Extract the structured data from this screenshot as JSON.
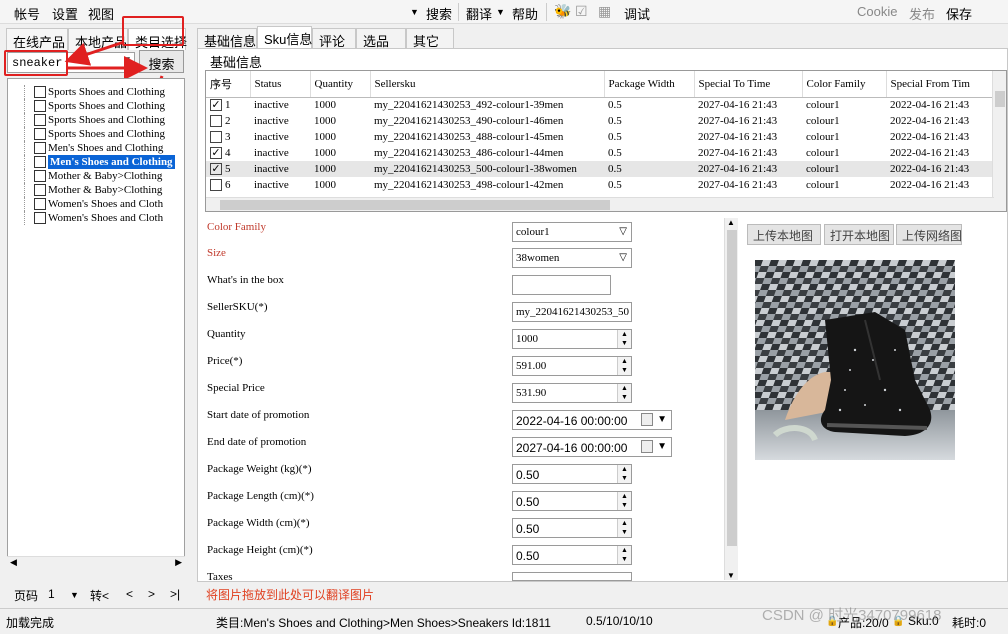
{
  "menu": {
    "account": "帐号",
    "settings": "设置",
    "view": "视图",
    "search": "搜索",
    "translate": "翻译",
    "help": "帮助",
    "debug": "调试",
    "cookie": "Cookie",
    "publish": "发布",
    "save": "保存"
  },
  "left_tabs": [
    "在线产品",
    "本地产品",
    "类目选择"
  ],
  "search": {
    "value": "sneaker",
    "button": "搜索"
  },
  "tree": [
    "Sports Shoes and Clothing",
    "Sports Shoes and Clothing",
    "Sports Shoes and Clothing",
    "Sports Shoes and Clothing",
    "Men's Shoes and Clothing",
    "Men's Shoes and Clothing",
    "Mother & Baby>Clothing",
    "Mother & Baby>Clothing",
    "Women's Shoes and Cloth",
    "Women's Shoes and Cloth"
  ],
  "pager": {
    "label": "页码",
    "page": "1",
    "goto": "转<",
    "prev": "<",
    "next": ">",
    "last": ">|"
  },
  "right_tabs": [
    "基础信息",
    "Sku信息",
    "评论",
    "选品",
    "其它"
  ],
  "group_title": "基础信息",
  "grid": {
    "headers": [
      "序号",
      "Status",
      "Quantity",
      "Sellersku",
      "Package Width",
      "Special To Time",
      "Color Family",
      "Special From Tim"
    ],
    "rows": [
      {
        "checked": true,
        "no": "1",
        "status": "inactive",
        "qty": "1000",
        "sku": "my_22041621430253_492-colour1-39men",
        "width": "0.5",
        "to": "2027-04-16 21:43",
        "color": "colour1",
        "from": "2022-04-16 21:43"
      },
      {
        "checked": false,
        "no": "2",
        "status": "inactive",
        "qty": "1000",
        "sku": "my_22041621430253_490-colour1-46men",
        "width": "0.5",
        "to": "2027-04-16 21:43",
        "color": "colour1",
        "from": "2022-04-16 21:43"
      },
      {
        "checked": false,
        "no": "3",
        "status": "inactive",
        "qty": "1000",
        "sku": "my_22041621430253_488-colour1-45men",
        "width": "0.5",
        "to": "2027-04-16 21:43",
        "color": "colour1",
        "from": "2022-04-16 21:43"
      },
      {
        "checked": true,
        "no": "4",
        "status": "inactive",
        "qty": "1000",
        "sku": "my_22041621430253_486-colour1-44men",
        "width": "0.5",
        "to": "2027-04-16 21:43",
        "color": "colour1",
        "from": "2022-04-16 21:43"
      },
      {
        "checked": true,
        "no": "5",
        "status": "inactive",
        "qty": "1000",
        "sku": "my_22041621430253_500-colour1-38women",
        "width": "0.5",
        "to": "2027-04-16 21:43",
        "color": "colour1",
        "from": "2022-04-16 21:43"
      },
      {
        "checked": false,
        "no": "6",
        "status": "inactive",
        "qty": "1000",
        "sku": "my_22041621430253_498-colour1-42men",
        "width": "0.5",
        "to": "2027-04-16 21:43",
        "color": "colour1",
        "from": "2022-04-16 21:43"
      }
    ]
  },
  "form": {
    "color_family": {
      "label": "Color Family",
      "value": "colour1"
    },
    "size": {
      "label": "Size",
      "value": "38women"
    },
    "whats_in_box": {
      "label": "What's in the box",
      "value": ""
    },
    "seller_sku": {
      "label": "SellerSKU(*)",
      "value": "my_22041621430253_50"
    },
    "quantity": {
      "label": "Quantity",
      "value": "1000"
    },
    "price": {
      "label": "Price(*)",
      "value": "591.00"
    },
    "special_price": {
      "label": "Special Price",
      "value": "531.90"
    },
    "start_date": {
      "label": "Start date of promotion",
      "value": "2022-04-16 00:00:00"
    },
    "end_date": {
      "label": "End date of promotion",
      "value": "2027-04-16 00:00:00"
    },
    "pkg_weight": {
      "label": "Package Weight (kg)(*)",
      "value": "0.50"
    },
    "pkg_length": {
      "label": "Package Length (cm)(*)",
      "value": "0.50"
    },
    "pkg_width": {
      "label": "Package Width (cm)(*)",
      "value": "0.50"
    },
    "pkg_height": {
      "label": "Package Height (cm)(*)",
      "value": "0.50"
    },
    "taxes": {
      "label": "Taxes",
      "value": ""
    }
  },
  "image_buttons": [
    "上传本地图",
    "打开本地图",
    "上传网络图"
  ],
  "drop_hint": "将图片拖放到此处可以翻译图片",
  "status": {
    "left": "加载完成",
    "category": "类目:Men's Shoes and Clothing>Men Shoes>Sneakers Id:1811",
    "dims": "0.5/10/10/10",
    "products": "产品:20/0",
    "sku": "Sku:0",
    "time": "耗时:0"
  },
  "watermark": "CSDN @ 时光3470799618"
}
